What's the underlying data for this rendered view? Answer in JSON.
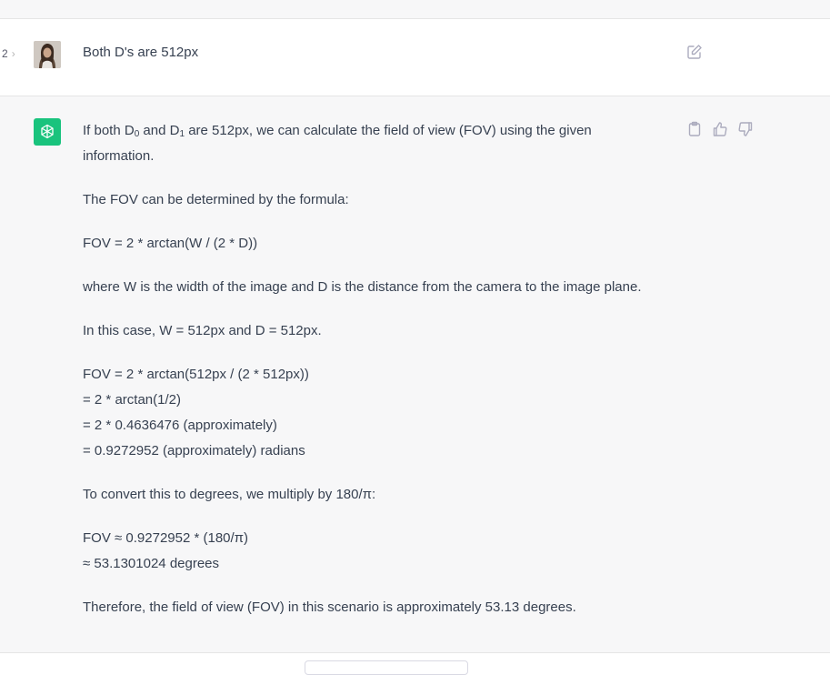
{
  "user_message": {
    "pager_number": "2",
    "pager_chevron": "›",
    "text": "Both D's are 512px",
    "avatar": "user-avatar",
    "edit_icon": "edit-icon"
  },
  "assistant_message": {
    "avatar": "openai-logo-icon",
    "action_icons": [
      "clipboard-icon",
      "thumbs-up-icon",
      "thumbs-down-icon"
    ],
    "intro_pre": "If both D",
    "intro_sub0": "0",
    "intro_mid": " and D",
    "intro_sub1": "1",
    "intro_post": " are 512px, we can calculate the field of view (FOV) using the given information.",
    "p2": "The FOV can be determined by the formula:",
    "p3": "FOV = 2 * arctan(W / (2 * D))",
    "p4": "where W is the width of the image and D is the distance from the camera to the image plane.",
    "p5": "In this case, W = 512px and D = 512px.",
    "calc": [
      "FOV = 2 * arctan(512px / (2 * 512px))",
      "= 2 * arctan(1/2)",
      "= 2 * 0.4636476 (approximately)",
      "= 0.9272952 (approximately) radians"
    ],
    "p7": "To convert this to degrees, we multiply by 180/π:",
    "deg": [
      "FOV ≈ 0.9272952 * (180/π)",
      "≈ 53.1301024 degrees"
    ],
    "p9": "Therefore, the field of view (FOV) in this scenario is approximately 53.13 degrees."
  },
  "colors": {
    "gpt_green": "#19c37d",
    "panel_bg": "#f7f7f8",
    "text": "#374151",
    "icon": "#acacbe"
  }
}
